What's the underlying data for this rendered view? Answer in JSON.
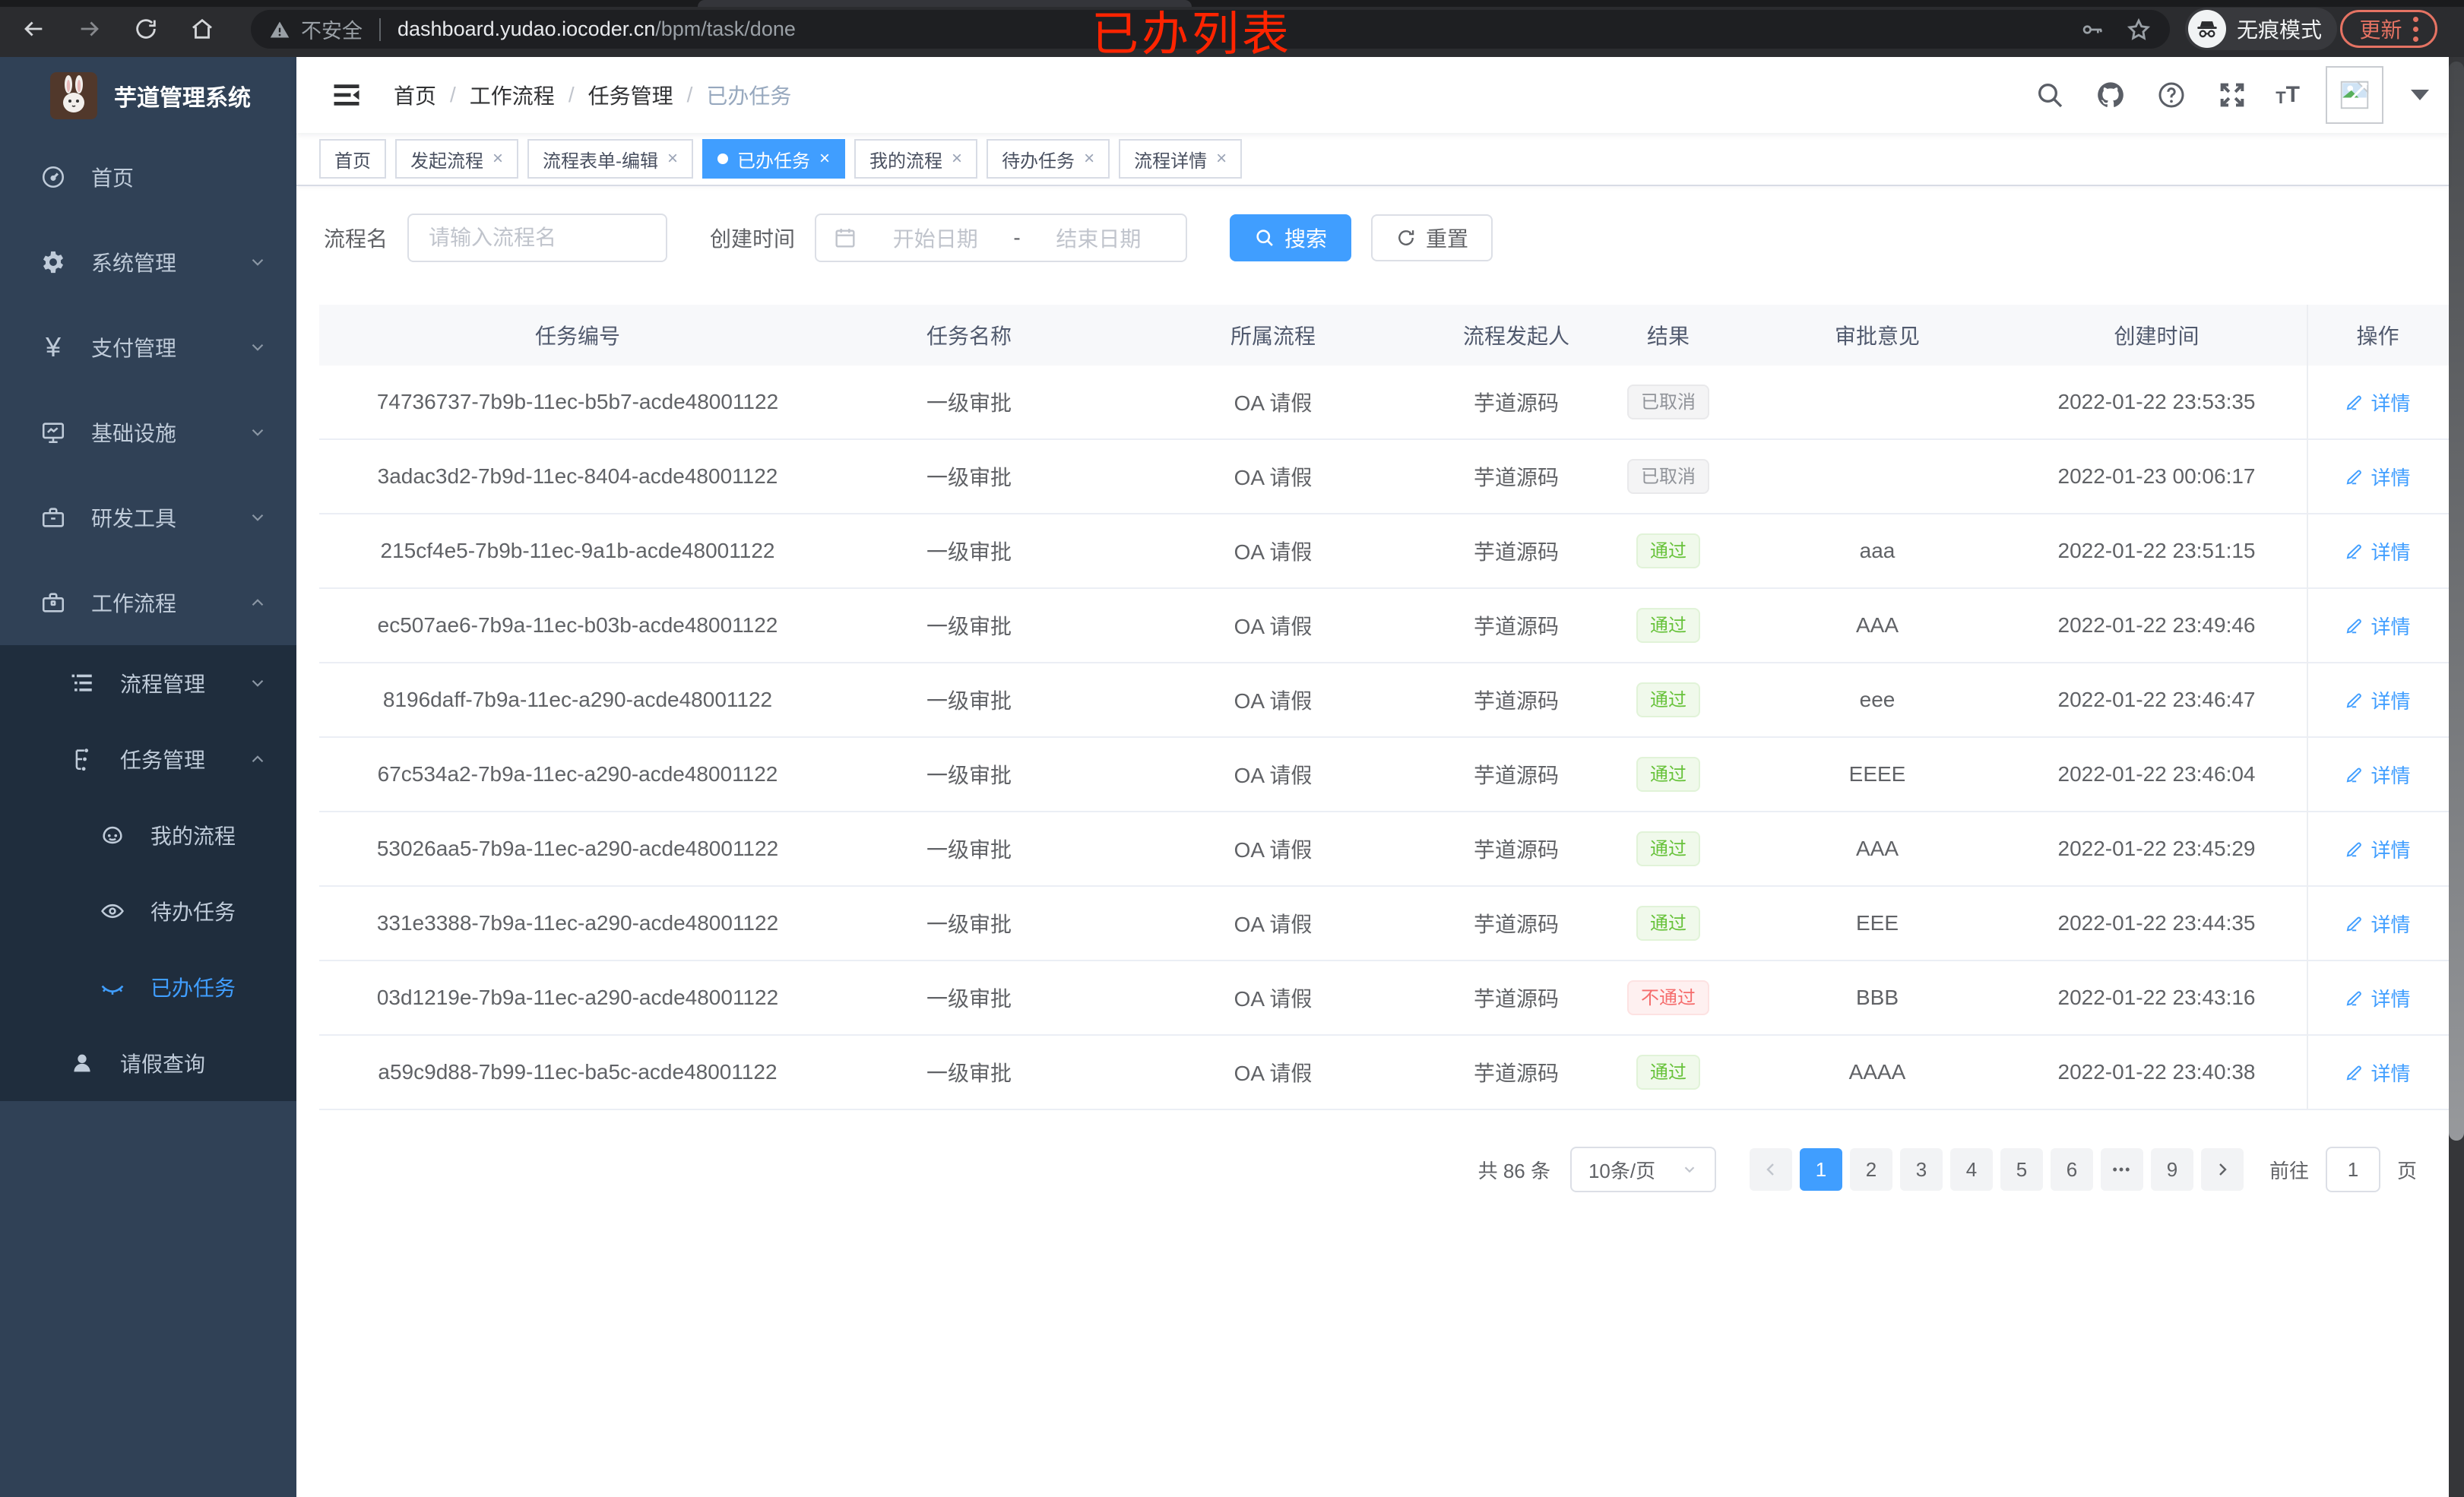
{
  "annotation": {
    "text": "已办列表",
    "color": "#ff2400"
  },
  "browser": {
    "security_label": "不安全",
    "url_host": "dashboard.yudao.iocoder.cn",
    "url_path": "/bpm/task/done",
    "incognito_label": "无痕模式",
    "update_label": "更新"
  },
  "sidebar": {
    "title": "芋道管理系统",
    "items": [
      {
        "label": "首页"
      },
      {
        "label": "系统管理"
      },
      {
        "label": "支付管理"
      },
      {
        "label": "基础设施"
      },
      {
        "label": "研发工具"
      },
      {
        "label": "工作流程"
      },
      {
        "label": "流程管理"
      },
      {
        "label": "任务管理"
      },
      {
        "label": "我的流程"
      },
      {
        "label": "待办任务"
      },
      {
        "label": "已办任务"
      },
      {
        "label": "请假查询"
      }
    ]
  },
  "header": {
    "breadcrumb": [
      "首页",
      "工作流程",
      "任务管理",
      "已办任务"
    ],
    "separator": "/"
  },
  "tabs": [
    {
      "label": "首页"
    },
    {
      "label": "发起流程"
    },
    {
      "label": "流程表单-编辑"
    },
    {
      "label": "已办任务"
    },
    {
      "label": "我的流程"
    },
    {
      "label": "待办任务"
    },
    {
      "label": "流程详情"
    }
  ],
  "glyphs": {
    "close": "×",
    "yen": "¥",
    "question": "?",
    "font_small": "T",
    "font_large": "T"
  },
  "filters": {
    "name_label": "流程名",
    "name_placeholder": "请输入流程名",
    "time_label": "创建时间",
    "start_placeholder": "开始日期",
    "range_separator": "-",
    "end_placeholder": "结束日期",
    "search_label": "搜索",
    "reset_label": "重置"
  },
  "table": {
    "columns": [
      "任务编号",
      "任务名称",
      "所属流程",
      "流程发起人",
      "结果",
      "审批意见",
      "创建时间",
      "操作"
    ],
    "detail_label": "详情",
    "rows": [
      {
        "id": "74736737-7b9b-11ec-b5b7-acde48001122",
        "name": "一级审批",
        "process": "OA 请假",
        "starter": "芋道源码",
        "result": "已取消",
        "result_type": "info",
        "comment": "",
        "created": "2022-01-22 23:53:35"
      },
      {
        "id": "3adac3d2-7b9d-11ec-8404-acde48001122",
        "name": "一级审批",
        "process": "OA 请假",
        "starter": "芋道源码",
        "result": "已取消",
        "result_type": "info",
        "comment": "",
        "created": "2022-01-23 00:06:17"
      },
      {
        "id": "215cf4e5-7b9b-11ec-9a1b-acde48001122",
        "name": "一级审批",
        "process": "OA 请假",
        "starter": "芋道源码",
        "result": "通过",
        "result_type": "success",
        "comment": "aaa",
        "created": "2022-01-22 23:51:15"
      },
      {
        "id": "ec507ae6-7b9a-11ec-b03b-acde48001122",
        "name": "一级审批",
        "process": "OA 请假",
        "starter": "芋道源码",
        "result": "通过",
        "result_type": "success",
        "comment": "AAA",
        "created": "2022-01-22 23:49:46"
      },
      {
        "id": "8196daff-7b9a-11ec-a290-acde48001122",
        "name": "一级审批",
        "process": "OA 请假",
        "starter": "芋道源码",
        "result": "通过",
        "result_type": "success",
        "comment": "eee",
        "created": "2022-01-22 23:46:47"
      },
      {
        "id": "67c534a2-7b9a-11ec-a290-acde48001122",
        "name": "一级审批",
        "process": "OA 请假",
        "starter": "芋道源码",
        "result": "通过",
        "result_type": "success",
        "comment": "EEEE",
        "created": "2022-01-22 23:46:04"
      },
      {
        "id": "53026aa5-7b9a-11ec-a290-acde48001122",
        "name": "一级审批",
        "process": "OA 请假",
        "starter": "芋道源码",
        "result": "通过",
        "result_type": "success",
        "comment": "AAA",
        "created": "2022-01-22 23:45:29"
      },
      {
        "id": "331e3388-7b9a-11ec-a290-acde48001122",
        "name": "一级审批",
        "process": "OA 请假",
        "starter": "芋道源码",
        "result": "通过",
        "result_type": "success",
        "comment": "EEE",
        "created": "2022-01-22 23:44:35"
      },
      {
        "id": "03d1219e-7b9a-11ec-a290-acde48001122",
        "name": "一级审批",
        "process": "OA 请假",
        "starter": "芋道源码",
        "result": "不通过",
        "result_type": "danger",
        "comment": "BBB",
        "created": "2022-01-22 23:43:16"
      },
      {
        "id": "a59c9d88-7b99-11ec-ba5c-acde48001122",
        "name": "一级审批",
        "process": "OA 请假",
        "starter": "芋道源码",
        "result": "通过",
        "result_type": "success",
        "comment": "AAAA",
        "created": "2022-01-22 23:40:38"
      }
    ]
  },
  "pagination": {
    "total": "共 86 条",
    "page_size": "10条/页",
    "pages": [
      "1",
      "2",
      "3",
      "4",
      "5",
      "6",
      "•••",
      "9"
    ],
    "goto_label": "前往",
    "goto_value": "1",
    "unit_label": "页"
  },
  "colors": {
    "accent": "#409eff",
    "success": "#67c23a",
    "danger": "#f56c6c",
    "info": "#909399",
    "sidebar": "#304156",
    "submenu": "#1f2d3d"
  }
}
